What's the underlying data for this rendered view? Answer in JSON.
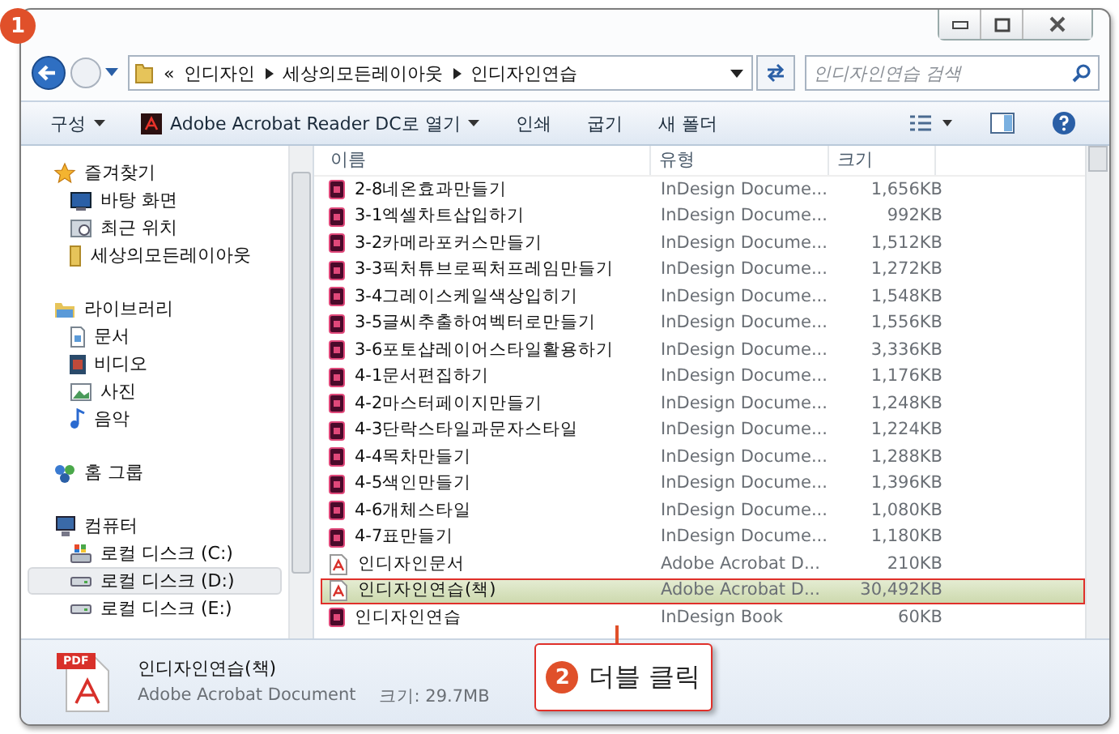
{
  "callouts": [
    {
      "number": "1"
    },
    {
      "number": "2",
      "text": "더블 클릭"
    }
  ],
  "address": {
    "crumbs": [
      "«",
      "인디자인",
      "세상의모든레이아웃",
      "인디자인연습"
    ]
  },
  "search": {
    "placeholder": "인디자인연습 검색"
  },
  "toolbar": {
    "items": [
      "구성",
      "Adobe Acrobat Reader DC로 열기",
      "인쇄",
      "굽기",
      "새 폴더"
    ]
  },
  "sidebar": {
    "groups": [
      {
        "label": "즐겨찾기",
        "children": [
          {
            "label": "바탕 화면",
            "selected": false
          },
          {
            "label": "최근 위치",
            "selected": false
          },
          {
            "label": "세상의모든레이아웃",
            "selected": false
          }
        ]
      },
      {
        "label": "라이브러리",
        "children": [
          {
            "label": "문서",
            "selected": false
          },
          {
            "label": "비디오",
            "selected": false
          },
          {
            "label": "사진",
            "selected": false
          },
          {
            "label": "음악",
            "selected": false
          }
        ]
      },
      {
        "label": "홈 그룹"
      },
      {
        "label": "컴퓨터",
        "children": [
          {
            "label": "로컬 디스크 (C:)",
            "selected": false
          },
          {
            "label": "로컬 디스크 (D:)",
            "selected": true
          },
          {
            "label": "로컬 디스크 (E:)",
            "selected": false
          }
        ]
      }
    ]
  },
  "table": {
    "columns": [
      "이름",
      "유형",
      "크기"
    ],
    "rows": [
      {
        "kind": "indesign",
        "name": "2-8네온효과만들기",
        "type": "InDesign Docume...",
        "size": "1,656KB",
        "selected": false
      },
      {
        "kind": "indesign",
        "name": "3-1엑셀차트삽입하기",
        "type": "InDesign Docume...",
        "size": "992KB",
        "selected": false
      },
      {
        "kind": "indesign",
        "name": "3-2카메라포커스만들기",
        "type": "InDesign Docume...",
        "size": "1,512KB",
        "selected": false
      },
      {
        "kind": "indesign",
        "name": "3-3픽처튜브로픽처프레임만들기",
        "type": "InDesign Docume...",
        "size": "1,272KB",
        "selected": false
      },
      {
        "kind": "indesign",
        "name": "3-4그레이스케일색상입히기",
        "type": "InDesign Docume...",
        "size": "1,548KB",
        "selected": false
      },
      {
        "kind": "indesign",
        "name": "3-5글씨추출하여벡터로만들기",
        "type": "InDesign Docume...",
        "size": "1,556KB",
        "selected": false
      },
      {
        "kind": "indesign",
        "name": "3-6포토샵레이어스타일활용하기",
        "type": "InDesign Docume...",
        "size": "3,336KB",
        "selected": false
      },
      {
        "kind": "indesign",
        "name": "4-1문서편집하기",
        "type": "InDesign Docume...",
        "size": "1,176KB",
        "selected": false
      },
      {
        "kind": "indesign",
        "name": "4-2마스터페이지만들기",
        "type": "InDesign Docume...",
        "size": "1,248KB",
        "selected": false
      },
      {
        "kind": "indesign",
        "name": "4-3단락스타일과문자스타일",
        "type": "InDesign Docume...",
        "size": "1,224KB",
        "selected": false
      },
      {
        "kind": "indesign",
        "name": "4-4목차만들기",
        "type": "InDesign Docume...",
        "size": "1,288KB",
        "selected": false
      },
      {
        "kind": "indesign",
        "name": "4-5색인만들기",
        "type": "InDesign Docume...",
        "size": "1,396KB",
        "selected": false
      },
      {
        "kind": "indesign",
        "name": "4-6개체스타일",
        "type": "InDesign Docume...",
        "size": "1,080KB",
        "selected": false
      },
      {
        "kind": "indesign",
        "name": "4-7표만들기",
        "type": "InDesign Docume...",
        "size": "1,180KB",
        "selected": false
      },
      {
        "kind": "pdf",
        "name": "인디자인문서",
        "type": "Adobe Acrobat D...",
        "size": "210KB",
        "selected": false
      },
      {
        "kind": "pdf",
        "name": "인디자인연습(책)",
        "type": "Adobe Acrobat D...",
        "size": "30,492KB",
        "selected": true
      },
      {
        "kind": "indesign",
        "name": "인디자인연습",
        "type": "InDesign Book",
        "size": "60KB",
        "selected": false
      }
    ]
  },
  "details": {
    "badge": "PDF",
    "name": "인디자인연습(책)",
    "type": "Adobe Acrobat Document",
    "size": "크기: 29.7MB"
  }
}
